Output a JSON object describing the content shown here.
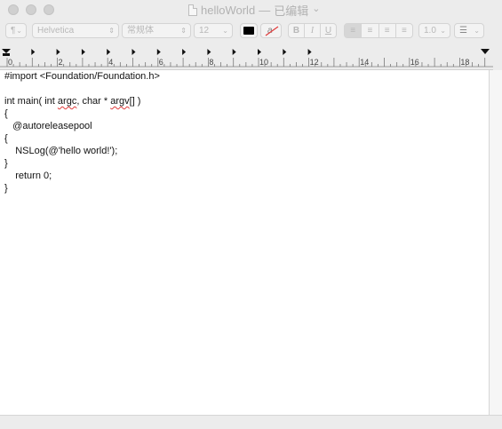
{
  "window": {
    "title": "helloWorld",
    "separator": "—",
    "status": "已编辑",
    "status_chevron": "⌄"
  },
  "toolbar": {
    "paragraph_style": "¶",
    "font_family": "Helvetica",
    "font_style": "常规体",
    "font_size": "12",
    "text_color": "#000000",
    "highlight_glyph": "a",
    "bold": "B",
    "italic": "I",
    "underline": "U",
    "align_left": "≡",
    "align_center": "≡",
    "align_right": "≡",
    "align_justify": "≡",
    "line_spacing": "1.0",
    "list": "☰"
  },
  "ruler": {
    "labels": [
      "0",
      "2",
      "4",
      "6",
      "8",
      "10",
      "12",
      "14",
      "16",
      "18"
    ]
  },
  "document": {
    "lines": [
      "#import <Foundation/Foundation.h>",
      "",
      "int main( int argc, char * argv[] )",
      "{",
      "   @autoreleasepool",
      "{",
      "    NSLog(@'hello world!');",
      "}",
      "    return 0;",
      "}"
    ],
    "main_prefix": "int main( int ",
    "main_argc": "argc",
    "main_mid": ", char * ",
    "main_argv": "argv",
    "main_suffix": "[] )"
  }
}
